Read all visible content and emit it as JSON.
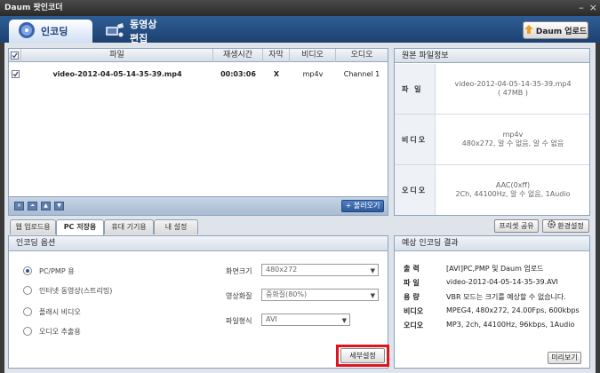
{
  "app": {
    "title": "Daum 팟인코더",
    "window_controls": [
      "–",
      "×"
    ]
  },
  "top_tabs": [
    {
      "label": "인코딩",
      "icon": "disc-icon"
    },
    {
      "label": "동영상 편집",
      "icon": "film-edit-icon"
    }
  ],
  "daum_upload_label": "Daum 업로드",
  "file_list": {
    "columns": [
      "파일",
      "재생시간",
      "자막",
      "비디오",
      "오디오"
    ],
    "rows": [
      {
        "name": "video-2012-04-05-14-35-39.mp4",
        "duration": "00:03:06",
        "subtitle": "X",
        "video": "mp4v",
        "audio": "Channel 1"
      }
    ],
    "load_label": "불러오기",
    "toolbar_icons": [
      "remove-icon",
      "move-top-icon",
      "move-up-icon",
      "move-down-icon"
    ]
  },
  "source_info": {
    "title": "원본 파일정보",
    "file_label": "파 일",
    "file_value_1": "video-2012-04-05-14-35-39.mp4",
    "file_value_2": "( 47MB )",
    "video_label": "비디오",
    "video_value_1": "mp4v",
    "video_value_2": "480x272, 알 수 없음, 알 수 없음",
    "audio_label": "오디오",
    "audio_value_1": "AAC(0xff)",
    "audio_value_2": "2Ch, 44100Hz, 알 수 없음, 1Audio"
  },
  "bottom_tabs": [
    "웹 업로드용",
    "PC 저장용",
    "휴대 기기용",
    "내 설정"
  ],
  "preset_share_label": "프리셋 공유",
  "env_settings_label": "환경설정",
  "encoding_options": {
    "title": "인코딩 옵션",
    "radios": [
      "PC/PMP 용",
      "인터넷 동영상(스트리밍)",
      "플래시 비디오",
      "오디오 추출용"
    ],
    "selected_index": 0,
    "screen_size_label": "화면크기",
    "screen_size_value": "480x272",
    "quality_label": "영상화질",
    "quality_value": "중화질(80%)",
    "format_label": "파일형식",
    "format_value": "AVI",
    "detail_settings_label": "세부설정"
  },
  "expected_result": {
    "title": "예상 인코딩 결과",
    "rows": [
      {
        "label": "출력",
        "value": "[AVI]PC,PMP 및 Daum 업로드"
      },
      {
        "label": "파일",
        "value": "video-2012-04-05-14-35-39.AVI"
      },
      {
        "label": "용량",
        "value": "VBR 모드는 크기를 예상할 수 없습니다."
      },
      {
        "label": "비디오",
        "value": "MPEG4, 480x272, 24.00Fps, 600kbps"
      },
      {
        "label": "오디오",
        "value": "MP3, 2ch, 44100Hz, 96kbps, 1Audio"
      }
    ],
    "preview_label": "미리보기"
  },
  "colors": {
    "accent_blue": "#2e5d96",
    "highlight_red": "#e0141e"
  }
}
